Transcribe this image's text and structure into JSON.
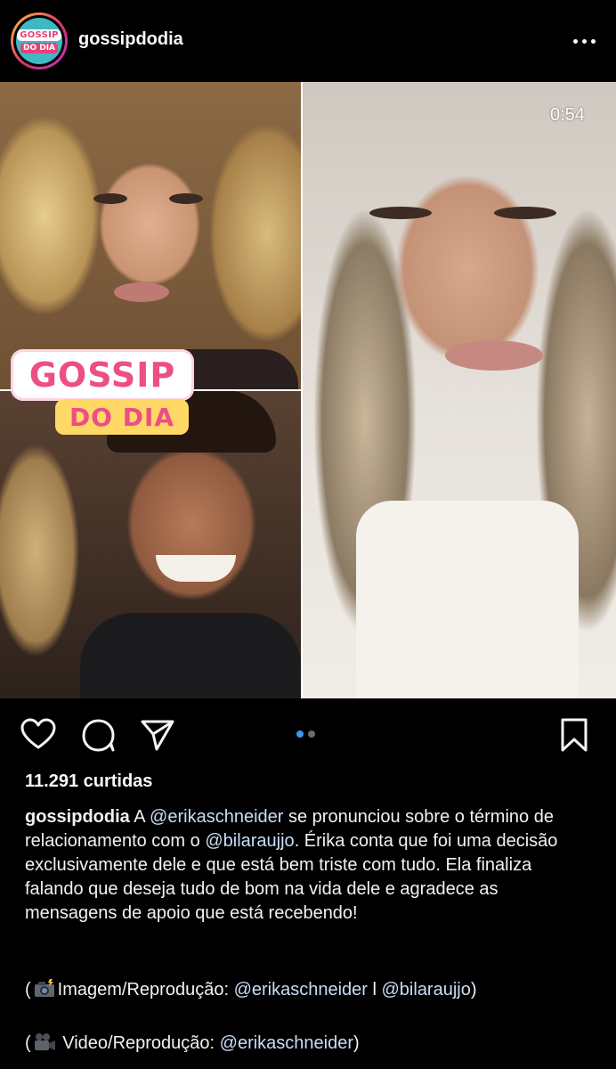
{
  "header": {
    "avatar_line1": "GOSSIP",
    "avatar_line2": "DO DIA",
    "username": "gossipdodia"
  },
  "media": {
    "brand_top": "GOSSIP",
    "brand_bottom": "DO DIA",
    "video_timer": "0:54",
    "carousel_total": 2,
    "carousel_active": 1
  },
  "actions": {
    "like_icon": "heart-icon",
    "comment_icon": "comment-icon",
    "share_icon": "send-icon",
    "save_icon": "bookmark-icon"
  },
  "post": {
    "likes": "11.291 curtidas",
    "caption_user": "gossipdodia",
    "caption_part1": " A ",
    "mention1": "@erikaschneider",
    "caption_part2": " se pronunciou sobre o término de relacionamento com o ",
    "mention2": "@bilaraujjo",
    "caption_part3": ". Érika conta que foi uma decisão exclusivamente dele e que está bem triste com tudo. Ela finaliza falando que deseja tudo de bom na vida dele e agradece as mensagens de apoio que está recebendo!",
    "credit1_open": "(",
    "credit1_emoji": "camera-with-flash-emoji",
    "credit1_text": "Imagem/Reprodução: ",
    "credit1_mention1": "@erikaschneider",
    "credit1_sep": " l ",
    "credit1_mention2": "@bilaraujjo",
    "credit1_close": ")",
    "credit2_open": "(",
    "credit2_emoji": "movie-camera-emoji",
    "credit2_text": " Video/Reprodução: ",
    "credit2_mention": "@erikaschneider",
    "credit2_close": ")"
  },
  "colors": {
    "background": "#000000",
    "text": "#f5f5f5",
    "mention": "#c9ddf7",
    "carousel_active": "#3897f0",
    "brand_pink": "#ec4e86",
    "brand_yellow": "#ffd866"
  }
}
